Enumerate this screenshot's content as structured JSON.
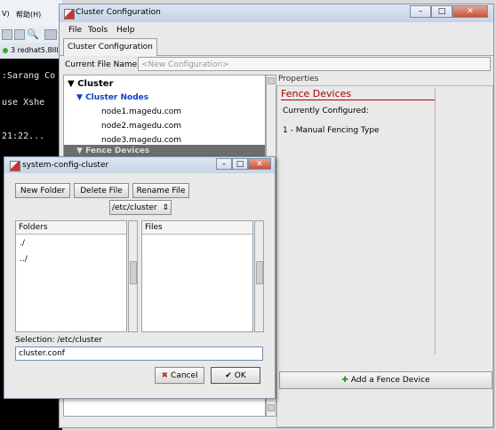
{
  "background": {
    "menu": [
      "V)",
      "帮助(H)"
    ],
    "tab": "3 redhat5.8III",
    "terminal_lines": [
      ":Sarang Co",
      " use Xshe",
      "21:22..."
    ]
  },
  "window": {
    "title": "Cluster Configuration",
    "menu": [
      "File",
      "Tools",
      "Help"
    ],
    "tab": "Cluster Configuration",
    "file_label": "Current File Name:",
    "file_placeholder": "<New Configuration>"
  },
  "tree": {
    "root": "Cluster",
    "nodes_label": "Cluster Nodes",
    "nodes": [
      "node1.magedu.com",
      "node2.magedu.com",
      "node3.magedu.com"
    ],
    "fence_label": "Fence Devices"
  },
  "properties": {
    "header": "Properties",
    "title": "Fence Devices",
    "configured_label": "Currently Configured:",
    "configured_item": "1 - Manual Fencing Type",
    "add_button": "Add a Fence Device"
  },
  "dialog": {
    "title": "system-config-cluster",
    "buttons": {
      "new_folder": "New Folder",
      "delete_file": "Delete File",
      "rename_file": "Rename File"
    },
    "path_combo": "/etc/cluster",
    "folders_header": "Folders",
    "folders": [
      "./",
      "../"
    ],
    "files_header": "Files",
    "selection_label": "Selection: /etc/cluster",
    "selection_value": "cluster.conf",
    "cancel": "Cancel",
    "ok": "OK"
  },
  "colors": {
    "fence_title": "#b00000",
    "tree_blue": "#0b3fc7",
    "selection_row": "#6d6d6d"
  }
}
